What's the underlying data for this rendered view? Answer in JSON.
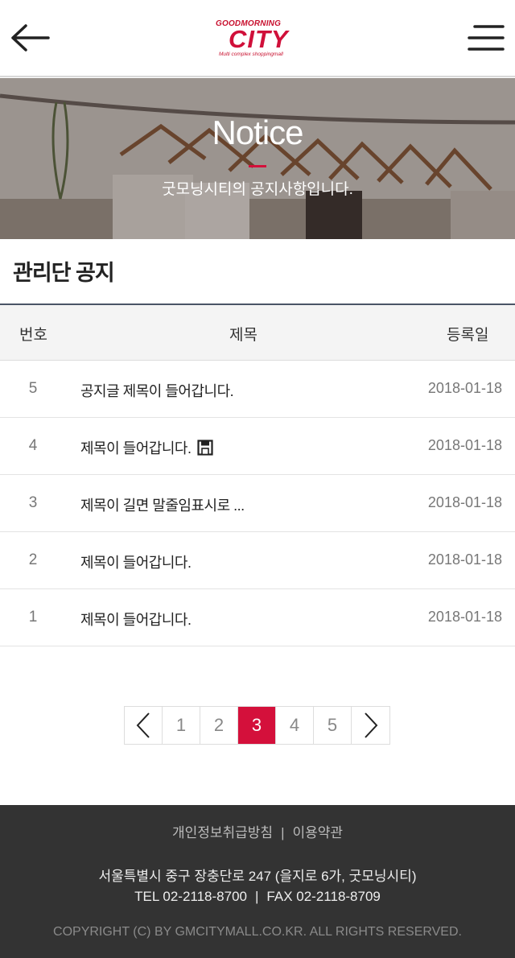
{
  "header": {
    "logo_top": "GOODMORNING",
    "logo_main": "CITY",
    "logo_sub": "Multi complex shoppingmall"
  },
  "banner": {
    "title": "Notice",
    "subtitle": "굿모닝시티의 공지사항입니다."
  },
  "section": {
    "title": "관리단 공지"
  },
  "table": {
    "headers": {
      "num": "번호",
      "title": "제목",
      "date": "등록일"
    },
    "rows": [
      {
        "num": "5",
        "title": "공지글 제목이 들어갑니다.",
        "date": "2018-01-18",
        "has_attachment": false
      },
      {
        "num": "4",
        "title": "제목이 들어갑니다.",
        "date": "2018-01-18",
        "has_attachment": true
      },
      {
        "num": "3",
        "title": "제목이 길면 말줄임표시로 ...",
        "date": "2018-01-18",
        "has_attachment": false
      },
      {
        "num": "2",
        "title": "제목이 들어갑니다.",
        "date": "2018-01-18",
        "has_attachment": false
      },
      {
        "num": "1",
        "title": "제목이 들어갑니다.",
        "date": "2018-01-18",
        "has_attachment": false
      }
    ]
  },
  "pagination": {
    "pages": [
      "1",
      "2",
      "3",
      "4",
      "5"
    ],
    "current": "3"
  },
  "footer": {
    "privacy": "개인정보취급방침",
    "separator": "|",
    "terms": "이용약관",
    "address": "서울특별시 중구 장충단로 247 (을지로 6가, 굿모닝시티)",
    "tel": "TEL 02-2118-8700",
    "fax": "FAX 02-2118-8709",
    "copyright": "COPYRIGHT (C) BY GMCITYMALL.CO.KR. ALL RIGHTS RESERVED."
  },
  "colors": {
    "accent": "#d4103b",
    "footer_bg": "#333333",
    "table_border": "#4a5466"
  }
}
